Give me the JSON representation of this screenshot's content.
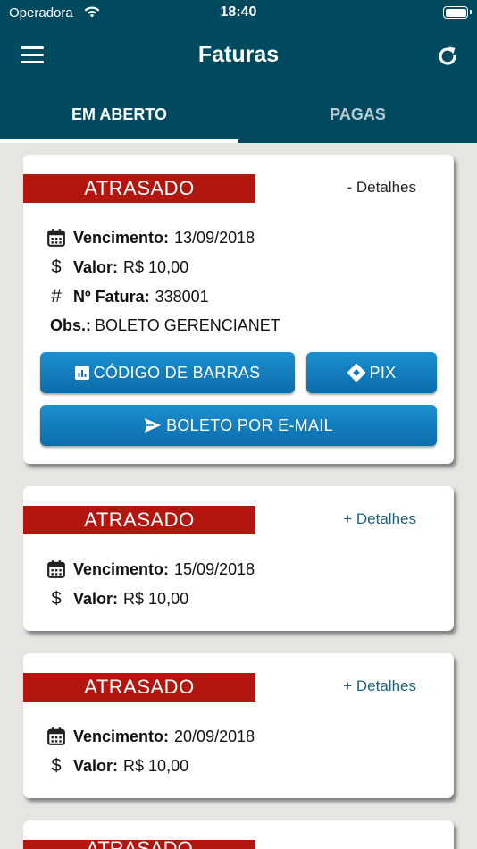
{
  "status_bar": {
    "carrier": "Operadora",
    "time": "18:40"
  },
  "header": {
    "title": "Faturas"
  },
  "tabs": [
    {
      "label": "EM ABERTO",
      "active": true
    },
    {
      "label": "PAGAS",
      "active": false
    }
  ],
  "labels": {
    "vencimento": "Vencimento:",
    "valor": "Valor:",
    "fatura": "Nº Fatura:",
    "obs": "Obs.:"
  },
  "invoices": [
    {
      "status": "ATRASADO",
      "details_toggle": "- Detalhes",
      "expanded": true,
      "vencimento": "13/09/2018",
      "valor": "R$ 10,00",
      "fatura": "338001",
      "obs": "BOLETO GERENCIANET",
      "buttons": {
        "barcode": "CÓDIGO DE BARRAS",
        "pix": "PIX",
        "email": "BOLETO POR E-MAIL"
      }
    },
    {
      "status": "ATRASADO",
      "details_toggle": "+ Detalhes",
      "expanded": false,
      "vencimento": "15/09/2018",
      "valor": "R$ 10,00"
    },
    {
      "status": "ATRASADO",
      "details_toggle": "+ Detalhes",
      "expanded": false,
      "vencimento": "20/09/2018",
      "valor": "R$ 10,00"
    },
    {
      "status": "ATRASADO"
    }
  ],
  "colors": {
    "header_bg": "#004a60",
    "status_badge": "#b3160f",
    "button": "#1178bb",
    "details_link": "#1d5f78",
    "page_bg": "#e6e5e2"
  }
}
